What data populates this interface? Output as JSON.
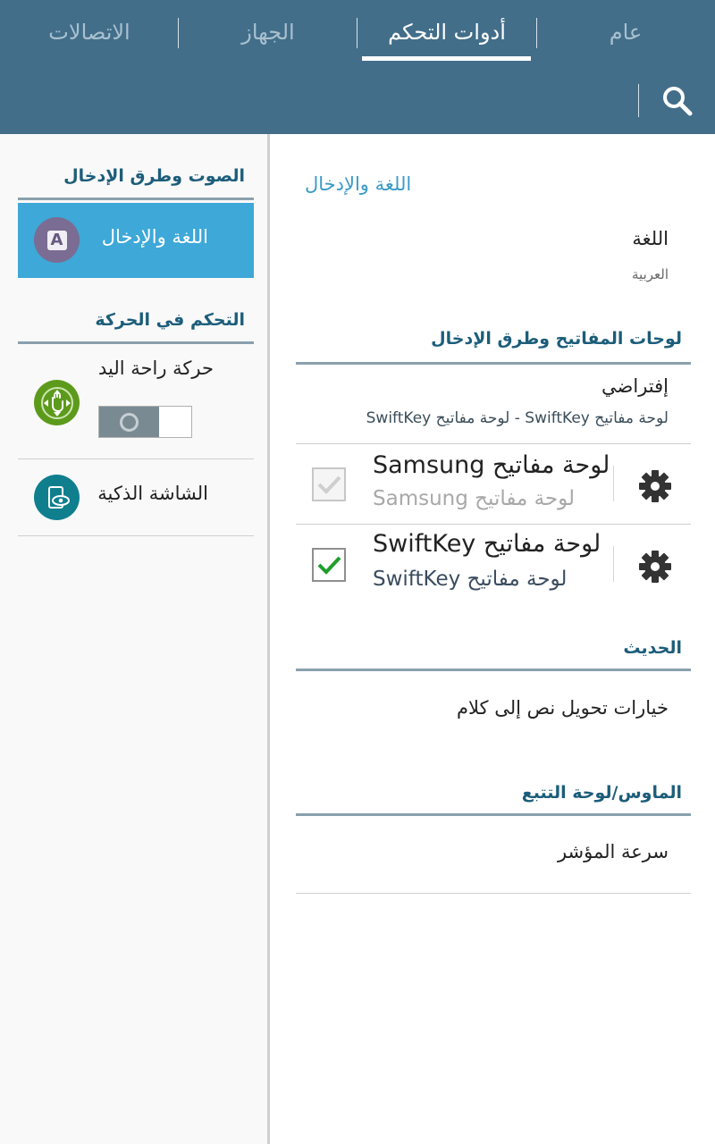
{
  "tabs": [
    {
      "label": "عام",
      "active": false
    },
    {
      "label": "أدوات التحكم",
      "active": true
    },
    {
      "label": "الجهاز",
      "active": false
    },
    {
      "label": "الاتصالات",
      "active": false
    }
  ],
  "left_pane": {
    "section_sound_input": "الصوت وطرق الإدخال",
    "selected_item_label": "اللغة والإدخال",
    "selected_item_icon_letter": "A",
    "section_motion": "التحكم في الحركة",
    "palm_motion_label": "حركة راحة اليد",
    "palm_motion_toggle": "off",
    "smart_screen_label": "الشاشة الذكية"
  },
  "right_pane": {
    "breadcrumb": "اللغة والإدخال",
    "language_title": "اللغة",
    "language_value": "العربية",
    "section_keyboards": "لوحات المفاتيح وطرق الإدخال",
    "default_title": "إفتراضي",
    "default_value": "لوحة مفاتيح SwiftKey - لوحة مفاتيح SwiftKey",
    "keyboards": [
      {
        "title": "لوحة مفاتيح Samsung",
        "subtitle": "لوحة مفاتيح Samsung",
        "checked": true,
        "enabled": false
      },
      {
        "title": "لوحة مفاتيح SwiftKey",
        "subtitle": "لوحة مفاتيح SwiftKey",
        "checked": true,
        "enabled": true
      }
    ],
    "section_speech": "الحديث",
    "tts_label": "خيارات تحويل نص إلى كلام",
    "section_mouse": "الماوس/لوحة التتبع",
    "pointer_speed_label": "سرعة المؤشر"
  },
  "colors": {
    "header_bg": "#426e8a",
    "accent_blue": "#3ea8d8",
    "section_text": "#1c5d7a",
    "check_green": "#1f9e2a"
  }
}
